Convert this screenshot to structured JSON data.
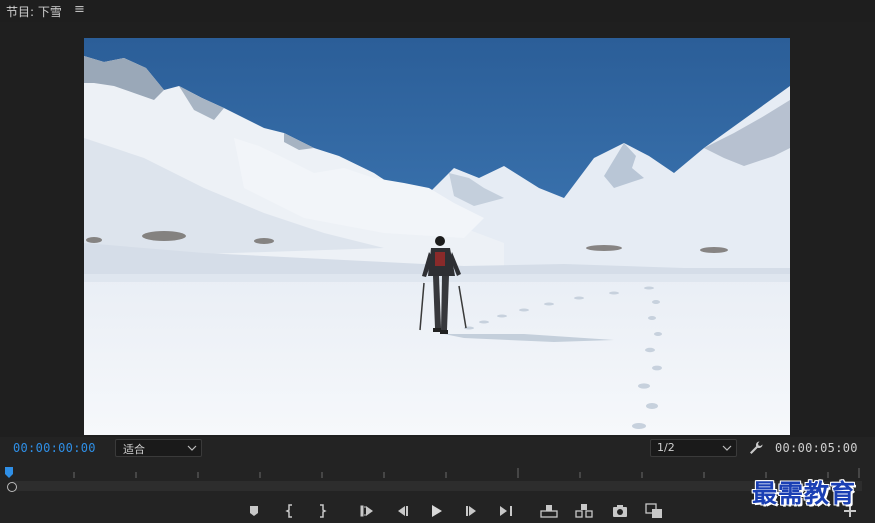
{
  "panel": {
    "title": "节目: 下雪",
    "menu_glyph": "≡"
  },
  "monitor": {
    "current_timecode": "00:00:00:00",
    "fit_value": "适合",
    "resolution_value": "1/2",
    "duration_timecode": "00:00:05:00"
  },
  "transport": {
    "buttons": [
      "add-marker",
      "mark-in",
      "mark-out",
      "go-to-in",
      "step-back",
      "play",
      "step-forward",
      "go-to-out",
      "lift",
      "extract",
      "export-frame",
      "compare-view",
      "button-editor"
    ]
  },
  "watermark": {
    "text": "最需教育"
  },
  "colors": {
    "timecode_accent": "#2f8fe6",
    "panel_bg": "#232323",
    "watermark": "#1a3fb4"
  }
}
